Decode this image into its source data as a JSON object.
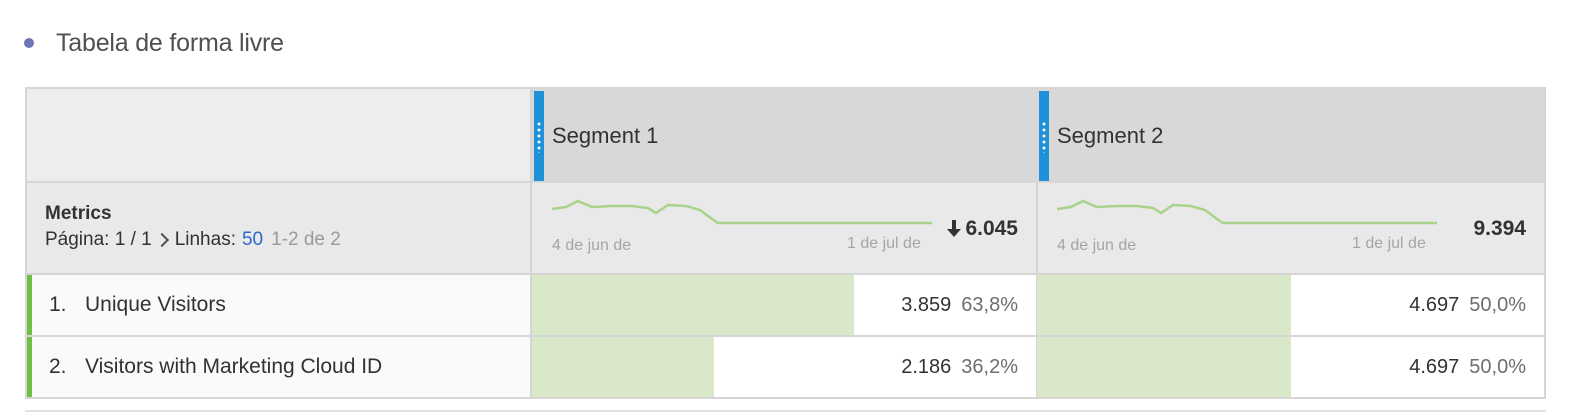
{
  "panel": {
    "title": "Tabela de forma livre"
  },
  "table": {
    "segments": [
      {
        "name": "Segment 1",
        "total": "6.045",
        "total_trend": "down",
        "spark_start": "4 de jun de",
        "spark_end": "1 de jul de"
      },
      {
        "name": "Segment 2",
        "total": "9.394",
        "spark_start": "4 de jun de",
        "spark_end": "1 de jul de"
      }
    ],
    "metrics_header": {
      "title": "Metrics",
      "page_label": "Página: 1 / 1",
      "rows_label": "Linhas:",
      "rows_value": "50",
      "range": "1-2 de 2"
    },
    "rows": [
      {
        "index": "1.",
        "label": "Unique Visitors",
        "cells": [
          {
            "value": "3.859",
            "pct": "63,8%",
            "fraction": 0.638
          },
          {
            "value": "4.697",
            "pct": "50,0%",
            "fraction": 0.5
          }
        ]
      },
      {
        "index": "2.",
        "label": "Visitors with Marketing Cloud ID",
        "cells": [
          {
            "value": "2.186",
            "pct": "36,2%",
            "fraction": 0.362
          },
          {
            "value": "4.697",
            "pct": "50,0%",
            "fraction": 0.5
          }
        ]
      }
    ]
  },
  "colors": {
    "segment_handle": "#1f91d9",
    "row_accent": "#72be44",
    "bar_fill": "#d9e8c9",
    "sparkline": "#a8d38a",
    "rows_link": "#2d69c8"
  }
}
